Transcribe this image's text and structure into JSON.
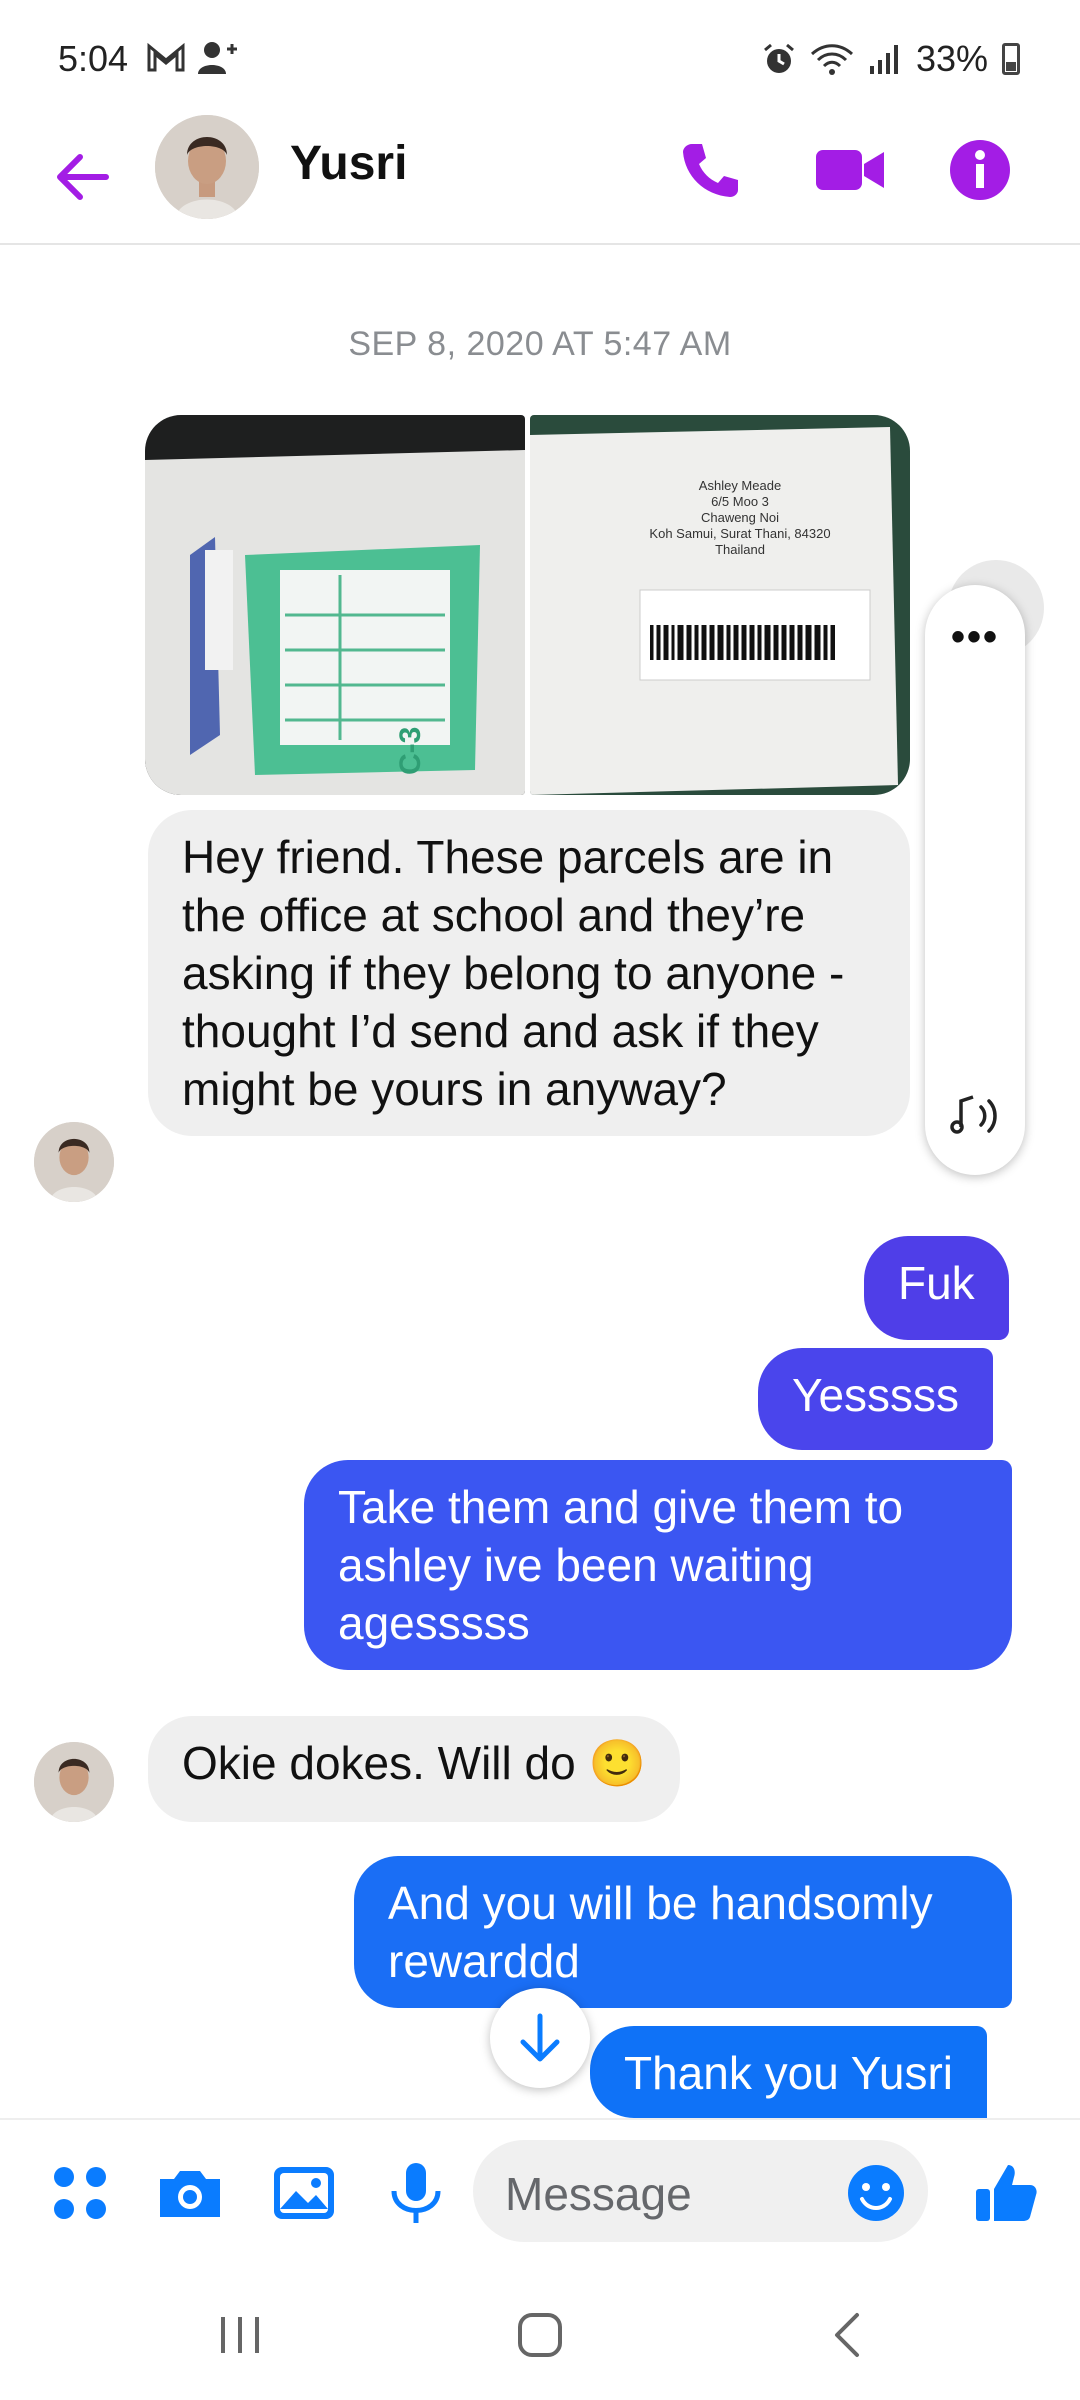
{
  "status_bar": {
    "time": "5:04",
    "battery": "33%"
  },
  "header": {
    "contact_name": "Yusri"
  },
  "conversation": {
    "date_separator": "SEP 8, 2020 AT 5:47 AM",
    "photo2_label": {
      "line1": "Ashley Meade",
      "line2": "6/5 Moo 3",
      "line3": "Chaweng Noi",
      "line4": "Koh Samui, Surat Thani, 84320",
      "line5": "Thailand"
    },
    "photo1_label": "C-3",
    "messages": [
      {
        "sender": "Yusri",
        "direction": "in",
        "text": "Hey friend. These parcels are in the office at school and they’re asking if they belong to anyone - thought I’d send and ask if they might be yours in anyway?"
      },
      {
        "direction": "out",
        "text": "Fuk"
      },
      {
        "direction": "out",
        "text": "Yesssss"
      },
      {
        "direction": "out",
        "text": "Take them and give them to ashley ive been waiting agesssss"
      },
      {
        "sender": "Yusri",
        "direction": "in",
        "text": "Okie dokes. Will do 🙂"
      },
      {
        "direction": "out",
        "text": "And you will be handsomly rewarddd"
      },
      {
        "direction": "out",
        "text": "Thank you Yusri"
      }
    ]
  },
  "side_panel": {
    "more": "•••"
  },
  "composer": {
    "placeholder": "Message"
  },
  "colors": {
    "accent_purple": "#a31de5",
    "bubble_purple": "#4f3ee8",
    "bubble_indigo": "#3b56f2",
    "bubble_blue": "#1a6ef5",
    "composer_blue": "#0a7cff"
  }
}
